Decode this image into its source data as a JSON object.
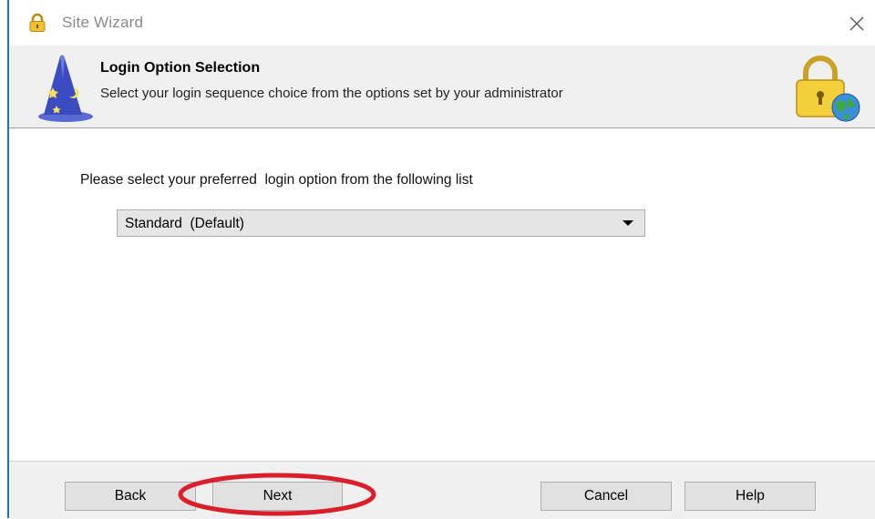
{
  "window": {
    "title": "Site Wizard",
    "title_icon": "padlock-icon",
    "close_icon": "close-icon"
  },
  "header": {
    "title": "Login Option Selection",
    "subtitle": "Select your login sequence choice from the options set by your administrator",
    "left_icon": "wizard-hat-icon",
    "right_icon": "lock-globe-icon"
  },
  "content": {
    "prompt": "Please select your preferred  login option from the following list",
    "login_option": {
      "selected": "Standard  (Default)"
    }
  },
  "footer": {
    "back_label": "Back",
    "next_label": "Next",
    "cancel_label": "Cancel",
    "help_label": "Help"
  },
  "annotation": {
    "highlight_color": "#d9202a",
    "highlight_target": "next-button"
  }
}
